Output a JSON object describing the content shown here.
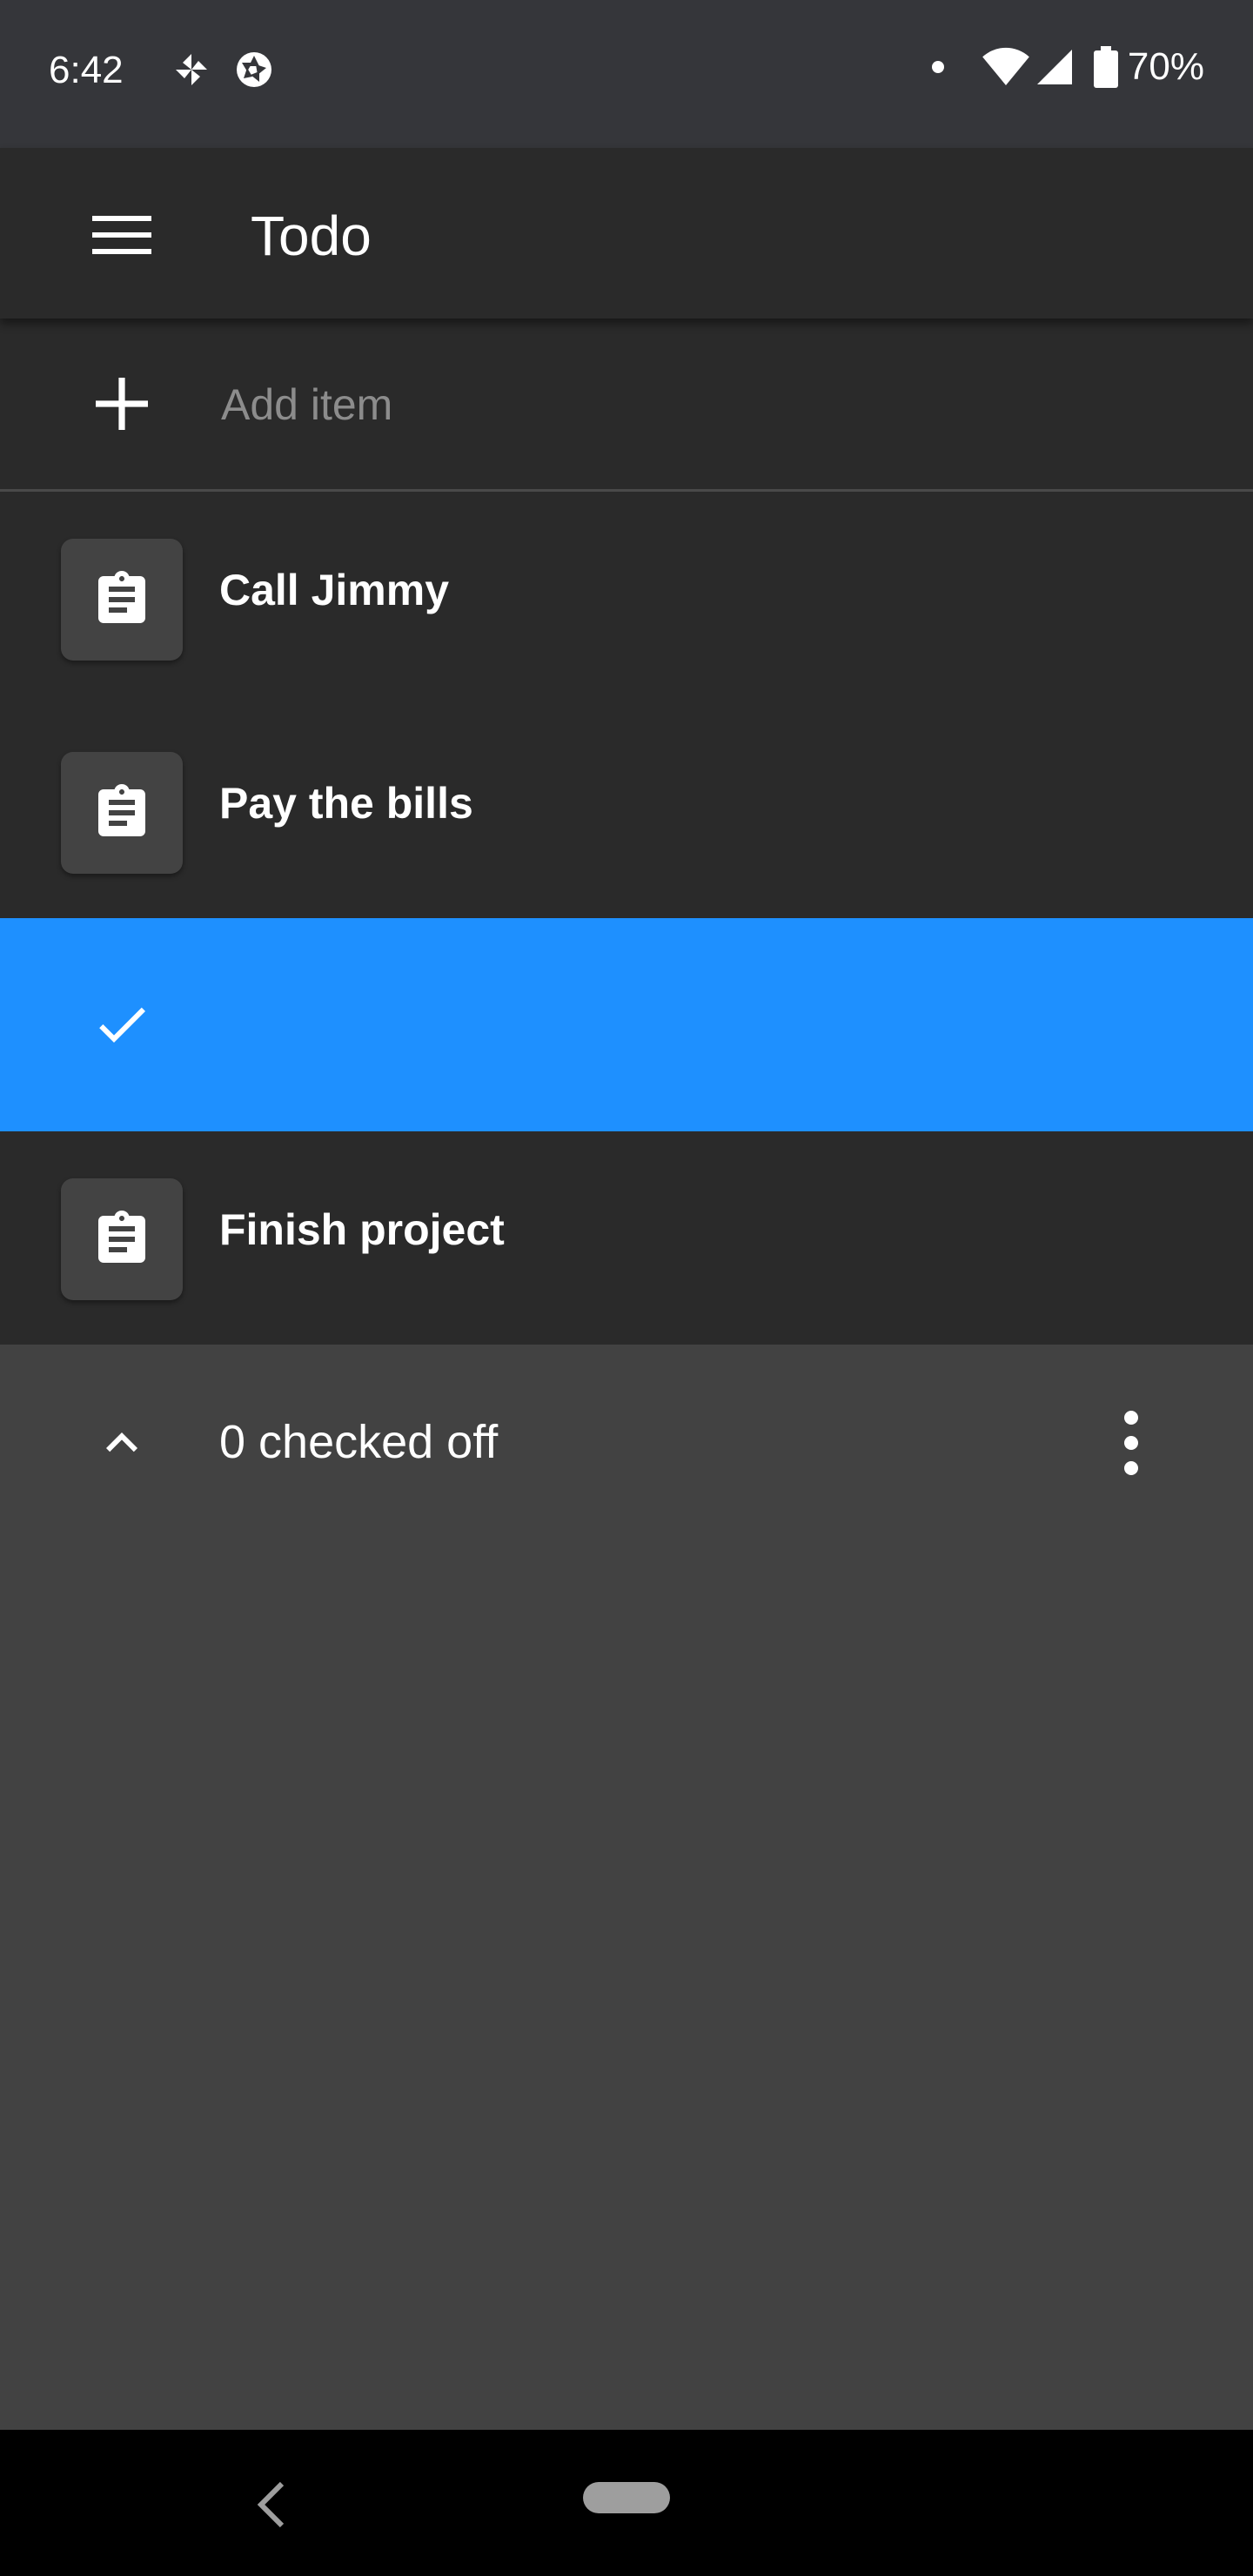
{
  "status_bar": {
    "time": "6:42",
    "battery_text": "70%",
    "icons": [
      "pinwheel-icon",
      "aperture-icon",
      "notification-dot-icon",
      "wifi-icon",
      "cell-signal-icon",
      "battery-icon"
    ]
  },
  "app_bar": {
    "title": "Todo",
    "menu_icon": "menu-icon"
  },
  "add_item": {
    "placeholder": "Add item",
    "icon": "plus-icon"
  },
  "items": [
    {
      "label": "Call Jimmy",
      "icon": "clipboard-icon",
      "selected": false
    },
    {
      "label": "Pay the bills",
      "icon": "clipboard-icon",
      "selected": false
    },
    {
      "label": "",
      "icon": "check-icon",
      "selected": true
    },
    {
      "label": "Finish project",
      "icon": "clipboard-icon",
      "selected": false
    }
  ],
  "checked_section": {
    "label": "0 checked off",
    "chevron_icon": "chevron-up-icon",
    "overflow_icon": "more-vert-icon"
  },
  "colors": {
    "status_bar_bg": "#35363a",
    "surface": "#2a2a2a",
    "background": "#424242",
    "selected": "#1e90ff",
    "nav_bar": "#000000"
  }
}
